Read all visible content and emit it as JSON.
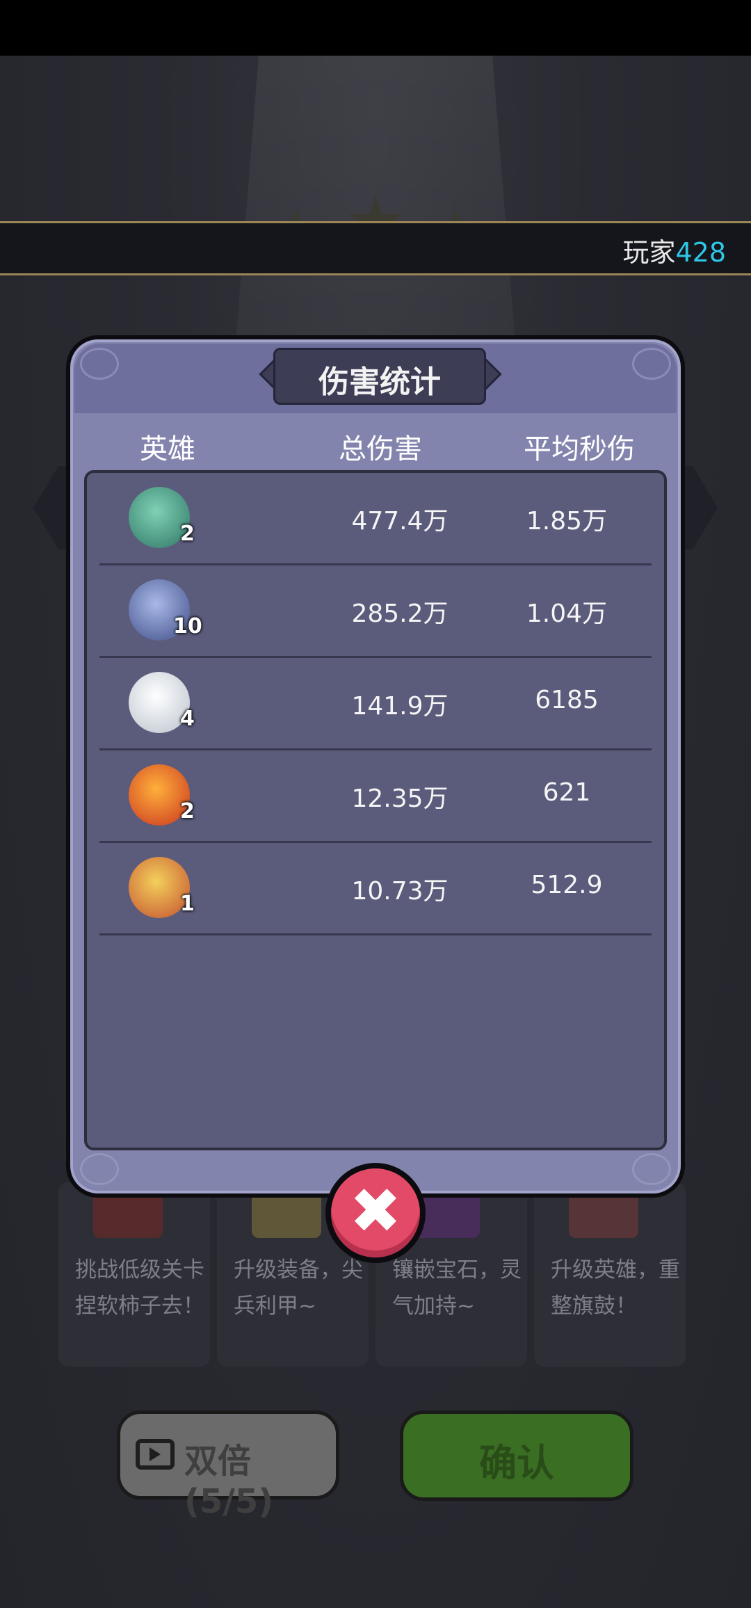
{
  "player": {
    "prefix": "玩家",
    "number": "428"
  },
  "panel": {
    "title": "伤害统计",
    "headers": {
      "hero": "英雄",
      "total": "总伤害",
      "dps": "平均秒伤"
    },
    "rows": [
      {
        "icon": "jade-dragon-hero-icon",
        "level": "2",
        "total": "477.4万",
        "dps": "1.85万",
        "color": "#3e8f7a"
      },
      {
        "icon": "hooded-mage-hero-icon",
        "level": "10",
        "total": "285.2万",
        "dps": "1.04万",
        "color": "#4d5f9c"
      },
      {
        "icon": "white-bearded-sage-hero-icon",
        "level": "4",
        "total": "141.9万",
        "dps": "6185",
        "color": "#cfd6de"
      },
      {
        "icon": "fire-spirit-hero-icon",
        "level": "2",
        "total": "12.35万",
        "dps": "621",
        "color": "#e25a2a"
      },
      {
        "icon": "golden-armored-warrior-hero-icon",
        "level": "1",
        "total": "10.73万",
        "dps": "512.9",
        "color": "#d9a234"
      }
    ]
  },
  "tips": [
    {
      "text": "挑战低级关卡捏软柿子去！",
      "icon": "stage-gate-icon"
    },
    {
      "text": "升级装备，尖兵利甲~",
      "icon": "equipment-icon"
    },
    {
      "text": "镶嵌宝石，灵气加持~",
      "icon": "gem-icon"
    },
    {
      "text": "升级英雄，重整旗鼓！",
      "icon": "hero-upgrade-icon"
    }
  ],
  "buttons": {
    "double": "双倍(5/5)",
    "confirm": "确认"
  },
  "colors": {
    "accent_cyan": "#2ec7e6",
    "close_red": "#e24a67",
    "confirm_green": "#3a6e23"
  }
}
